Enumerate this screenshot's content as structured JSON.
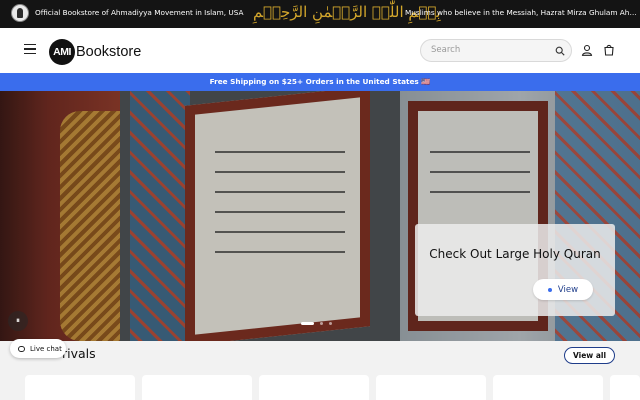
{
  "topbar": {
    "emblem_icon": "ahmadiyya-emblem-icon",
    "official_text": "Official Bookstore of Ahmadiyya Movement in Islam, USA",
    "bismillah": "بِسۡمِ اللّٰہِ الرَّحۡمٰنِ الرَّحِیۡمِ",
    "marquee_text": "Muslims who believe in the Messiah, Hazrat Mirza Ghulam Ahmad"
  },
  "header": {
    "logo_badge": "AMI",
    "logo_name": "Bookstore",
    "search_placeholder": "Search",
    "icons": [
      "menu-icon",
      "search-icon",
      "account-icon",
      "cart-icon"
    ]
  },
  "shipping_banner": {
    "text": "Free Shipping on $25+ Orders in the United States 🇺🇸"
  },
  "hero": {
    "promo_title": "Check Out Large Holy Quran",
    "promo_button": "View",
    "slide_count": 3,
    "active_slide": 1,
    "pause_symbol": "⏸"
  },
  "section": {
    "title": "rivals",
    "view_all": "View all"
  },
  "live_chat": {
    "label": "Live chat"
  },
  "colors": {
    "topbar_bg": "#141414",
    "banner_bg": "#3a6ded",
    "gold": "#d4a72c",
    "accent_text": "#1f3d8a"
  }
}
